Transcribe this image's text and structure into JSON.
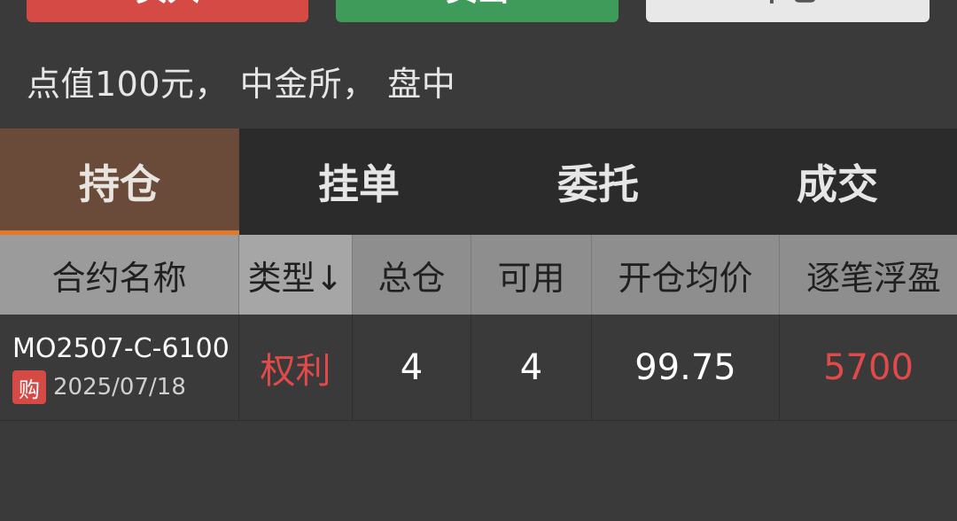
{
  "actions": {
    "buy_label": "买入",
    "sell_label": "卖出",
    "close_label": "平仓"
  },
  "info_line": "点值100元， 中金所， 盘中",
  "tabs": [
    {
      "label": "持仓",
      "active": true
    },
    {
      "label": "挂单",
      "active": false
    },
    {
      "label": "委托",
      "active": false
    },
    {
      "label": "成交",
      "active": false
    }
  ],
  "table": {
    "headers": {
      "name": "合约名称",
      "type": "类型↓",
      "total": "总仓",
      "available": "可用",
      "avg_price": "开仓均价",
      "pnl": "逐笔浮盈"
    },
    "rows": [
      {
        "name": "MO2507-C-6100",
        "side_badge": "购",
        "date": "2025/07/18",
        "type": "权利",
        "total": "4",
        "available": "4",
        "avg_price": "99.75",
        "pnl": "5700"
      }
    ]
  },
  "colors": {
    "buy": "#d54a45",
    "sell": "#3f9b5a",
    "active_tab": "#6a4a38",
    "tab_underline": "#e2782a",
    "profit": "#e24a4a"
  }
}
